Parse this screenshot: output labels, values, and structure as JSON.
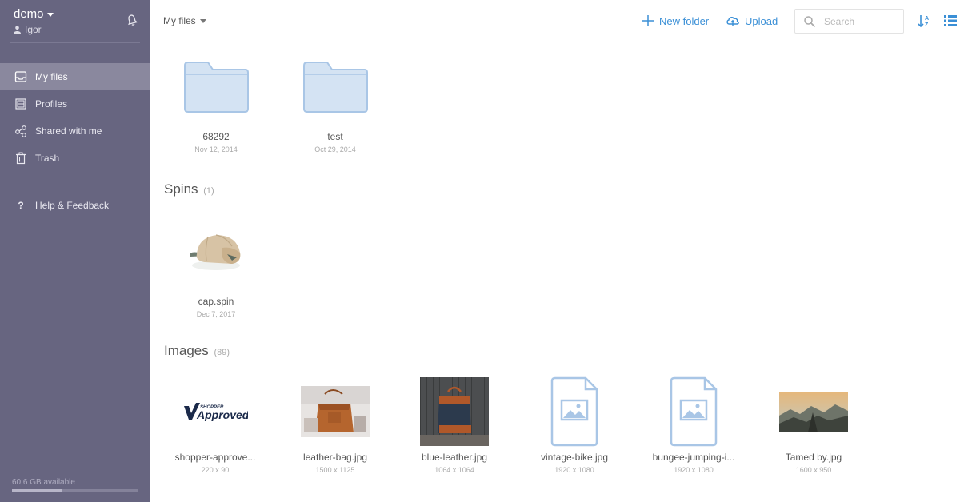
{
  "sidebar": {
    "account_name": "demo",
    "user_name": "Igor",
    "nav": [
      {
        "label": "My files",
        "icon": "inbox-icon"
      },
      {
        "label": "Profiles",
        "icon": "profiles-icon"
      },
      {
        "label": "Shared with me",
        "icon": "share-icon"
      },
      {
        "label": "Trash",
        "icon": "trash-icon"
      }
    ],
    "help_label": "Help & Feedback",
    "storage_text": "60.6 GB available",
    "storage_used_fraction": 0.4
  },
  "topbar": {
    "breadcrumb": "My files",
    "new_folder_label": "New folder",
    "upload_label": "Upload",
    "search_placeholder": "Search",
    "accent_color": "#3a8fd6"
  },
  "folders": [
    {
      "name": "68292",
      "date": "Nov 12, 2014"
    },
    {
      "name": "test",
      "date": "Oct 29, 2014"
    }
  ],
  "spins": {
    "title": "Spins",
    "count": "(1)",
    "items": [
      {
        "name": "cap.spin",
        "date": "Dec 7, 2017"
      }
    ]
  },
  "images": {
    "title": "Images",
    "count": "(89)",
    "items": [
      {
        "name": "shopper-approve...",
        "size": "220 x 90",
        "logo_small": "SHOPPER",
        "logo_big": "Approved"
      },
      {
        "name": "leather-bag.jpg",
        "size": "1500 x 1125"
      },
      {
        "name": "blue-leather.jpg",
        "size": "1064 x 1064"
      },
      {
        "name": "vintage-bike.jpg",
        "size": "1920 x 1080"
      },
      {
        "name": "bungee-jumping-i...",
        "size": "1920 x 1080"
      },
      {
        "name": "Tamed by.jpg",
        "size": "1600 x 950"
      }
    ]
  }
}
